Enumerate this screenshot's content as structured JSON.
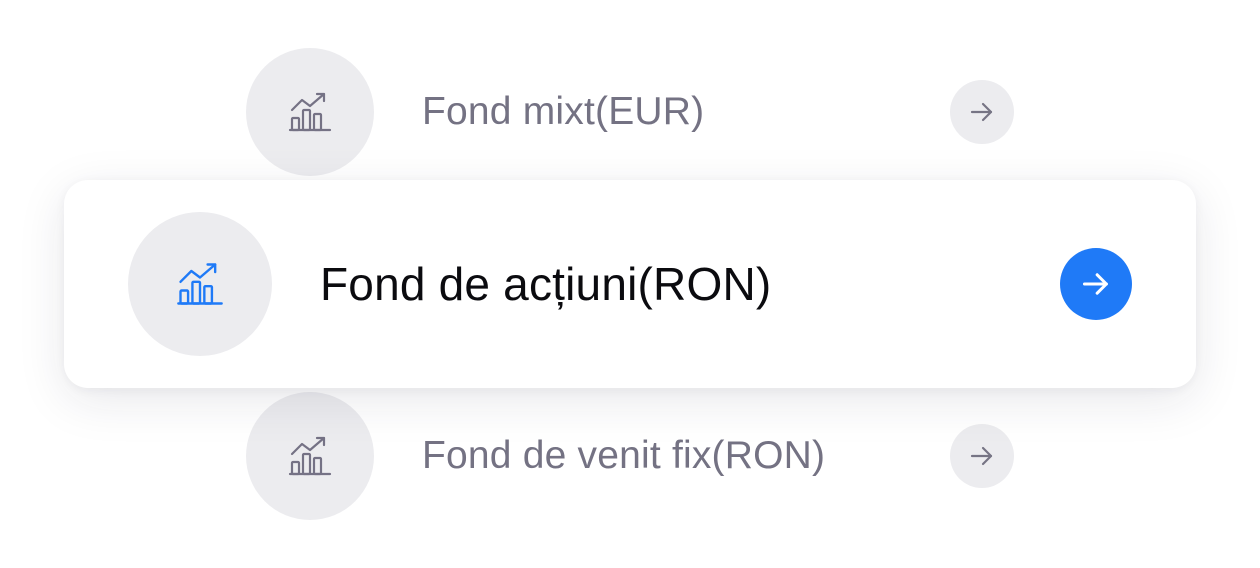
{
  "funds": [
    {
      "label": "Fond mixt(EUR)",
      "icon": "chart-trend-icon",
      "arrow_icon": "arrow-right-icon",
      "active": false
    },
    {
      "label": "Fond de acțiuni(RON)",
      "icon": "chart-trend-icon",
      "arrow_icon": "arrow-right-icon",
      "active": true
    },
    {
      "label": "Fond de venit fix(RON)",
      "icon": "chart-trend-icon",
      "arrow_icon": "arrow-right-icon",
      "active": false
    }
  ],
  "colors": {
    "accent": "#1f7af7",
    "icon_inactive": "#757285",
    "label_inactive": "#747283",
    "label_active": "#0b0b0f",
    "circle_bg": "#ececef",
    "card_bg": "#ffffff"
  }
}
